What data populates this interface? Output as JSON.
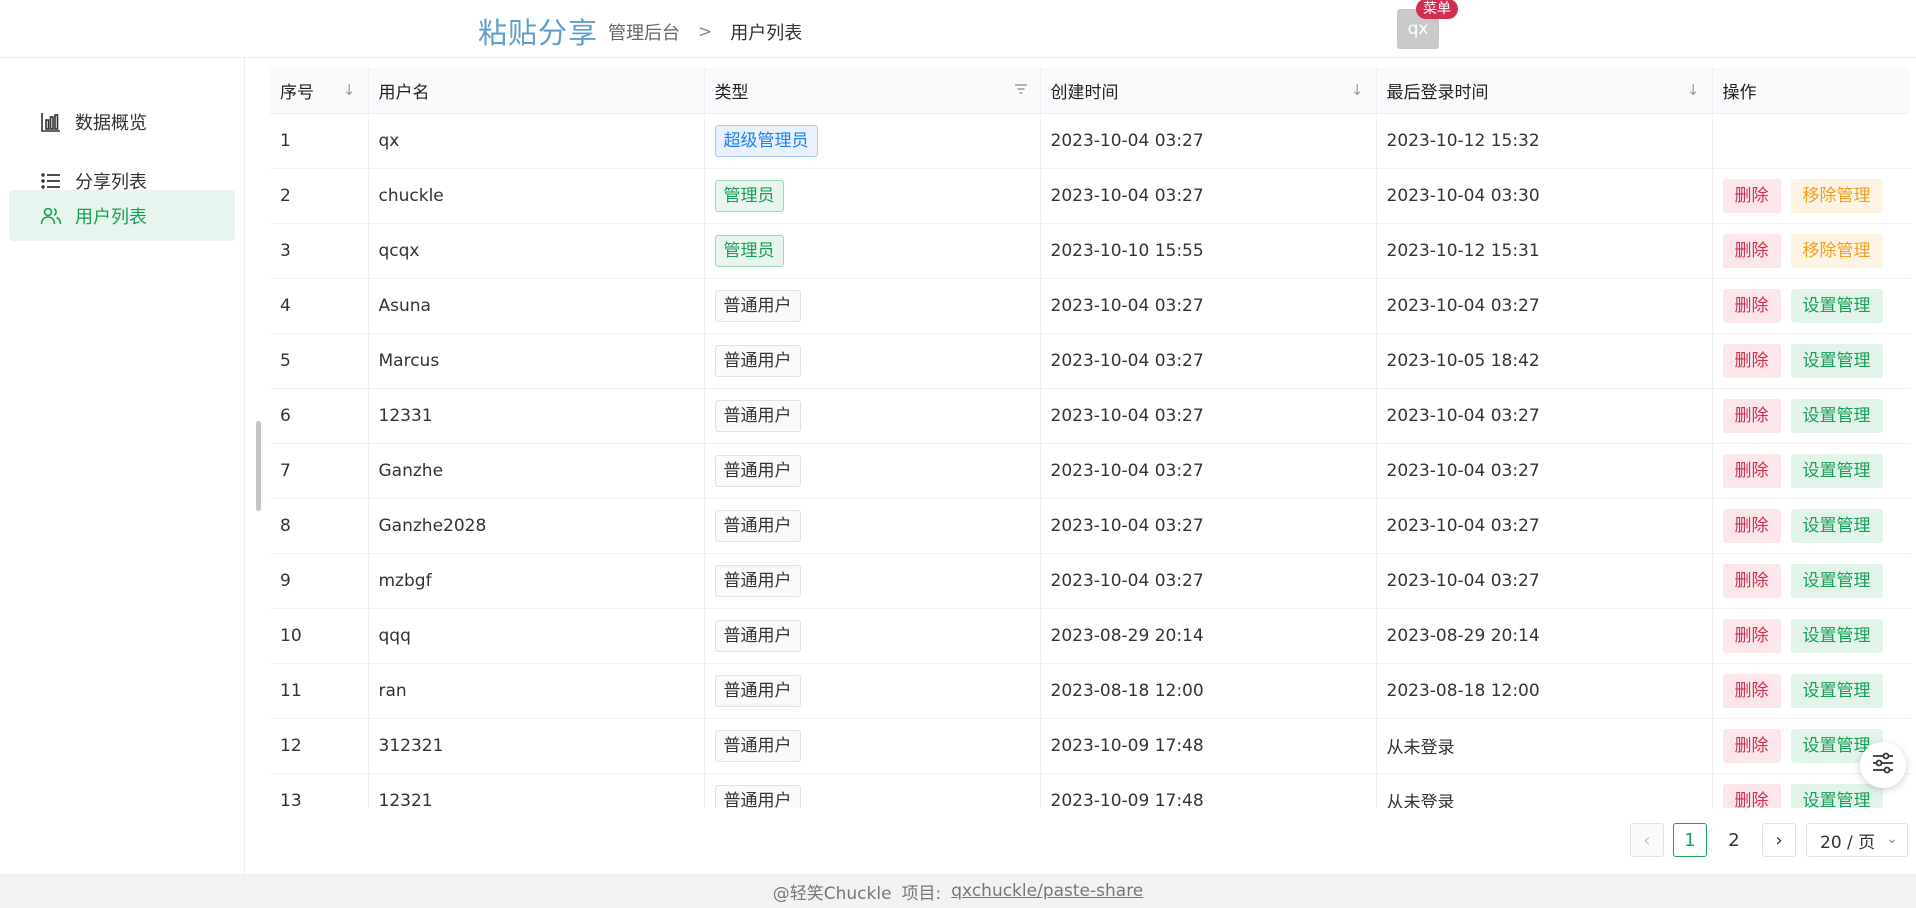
{
  "header": {
    "brand": "粘贴分享",
    "breadcrumb": [
      "管理后台",
      "用户列表"
    ],
    "breadcrumb_sep": ">",
    "avatar_text": "qx",
    "menu_badge": "菜单"
  },
  "sidebar": {
    "items": [
      {
        "label": "数据概览",
        "icon": "bar-chart-icon",
        "active": false
      },
      {
        "label": "分享列表",
        "icon": "list-icon",
        "active": false
      },
      {
        "label": "用户列表",
        "icon": "users-icon",
        "active": true
      }
    ]
  },
  "table": {
    "columns": [
      "序号",
      "用户名",
      "类型",
      "创建时间",
      "最后登录时间",
      "操作"
    ],
    "rows": [
      {
        "no": "1",
        "username": "qx",
        "type": "超级管理员",
        "type_kind": "super",
        "created": "2023-10-04 03:27",
        "last_login": "2023-10-12 15:32",
        "actions": []
      },
      {
        "no": "2",
        "username": "chuckle",
        "type": "管理员",
        "type_kind": "admin",
        "created": "2023-10-04 03:27",
        "last_login": "2023-10-04 03:30",
        "actions": [
          "删除",
          "移除管理"
        ]
      },
      {
        "no": "3",
        "username": "qcqx",
        "type": "管理员",
        "type_kind": "admin",
        "created": "2023-10-10 15:55",
        "last_login": "2023-10-12 15:31",
        "actions": [
          "删除",
          "移除管理"
        ]
      },
      {
        "no": "4",
        "username": "Asuna",
        "type": "普通用户",
        "type_kind": "normal",
        "created": "2023-10-04 03:27",
        "last_login": "2023-10-04 03:27",
        "actions": [
          "删除",
          "设置管理"
        ]
      },
      {
        "no": "5",
        "username": "Marcus",
        "type": "普通用户",
        "type_kind": "normal",
        "created": "2023-10-04 03:27",
        "last_login": "2023-10-05 18:42",
        "actions": [
          "删除",
          "设置管理"
        ]
      },
      {
        "no": "6",
        "username": "12331",
        "type": "普通用户",
        "type_kind": "normal",
        "created": "2023-10-04 03:27",
        "last_login": "2023-10-04 03:27",
        "actions": [
          "删除",
          "设置管理"
        ]
      },
      {
        "no": "7",
        "username": "Ganzhe",
        "type": "普通用户",
        "type_kind": "normal",
        "created": "2023-10-04 03:27",
        "last_login": "2023-10-04 03:27",
        "actions": [
          "删除",
          "设置管理"
        ]
      },
      {
        "no": "8",
        "username": "Ganzhe2028",
        "type": "普通用户",
        "type_kind": "normal",
        "created": "2023-10-04 03:27",
        "last_login": "2023-10-04 03:27",
        "actions": [
          "删除",
          "设置管理"
        ]
      },
      {
        "no": "9",
        "username": "mzbgf",
        "type": "普通用户",
        "type_kind": "normal",
        "created": "2023-10-04 03:27",
        "last_login": "2023-10-04 03:27",
        "actions": [
          "删除",
          "设置管理"
        ]
      },
      {
        "no": "10",
        "username": "qqq",
        "type": "普通用户",
        "type_kind": "normal",
        "created": "2023-08-29 20:14",
        "last_login": "2023-08-29 20:14",
        "actions": [
          "删除",
          "设置管理"
        ]
      },
      {
        "no": "11",
        "username": "ran",
        "type": "普通用户",
        "type_kind": "normal",
        "created": "2023-08-18 12:00",
        "last_login": "2023-08-18 12:00",
        "actions": [
          "删除",
          "设置管理"
        ]
      },
      {
        "no": "12",
        "username": "312321",
        "type": "普通用户",
        "type_kind": "normal",
        "created": "2023-10-09 17:48",
        "last_login": "从未登录",
        "actions": [
          "删除",
          "设置管理"
        ]
      },
      {
        "no": "13",
        "username": "12321",
        "type": "普通用户",
        "type_kind": "normal",
        "created": "2023-10-09 17:48",
        "last_login": "从未登录",
        "actions": [
          "删除",
          "设置管理"
        ]
      }
    ]
  },
  "pagination": {
    "pages": [
      "1",
      "2"
    ],
    "current": "1",
    "page_size": "20 / 页"
  },
  "footer": {
    "author": "@轻笑Chuckle",
    "project_label": "项目:",
    "project_link": "qxchuckle/paste-share"
  },
  "colors": {
    "brand": "#5f9ecd",
    "primary": "#18a058",
    "danger": "#d03050",
    "warning": "#f0a020",
    "info": "#2080f0"
  }
}
